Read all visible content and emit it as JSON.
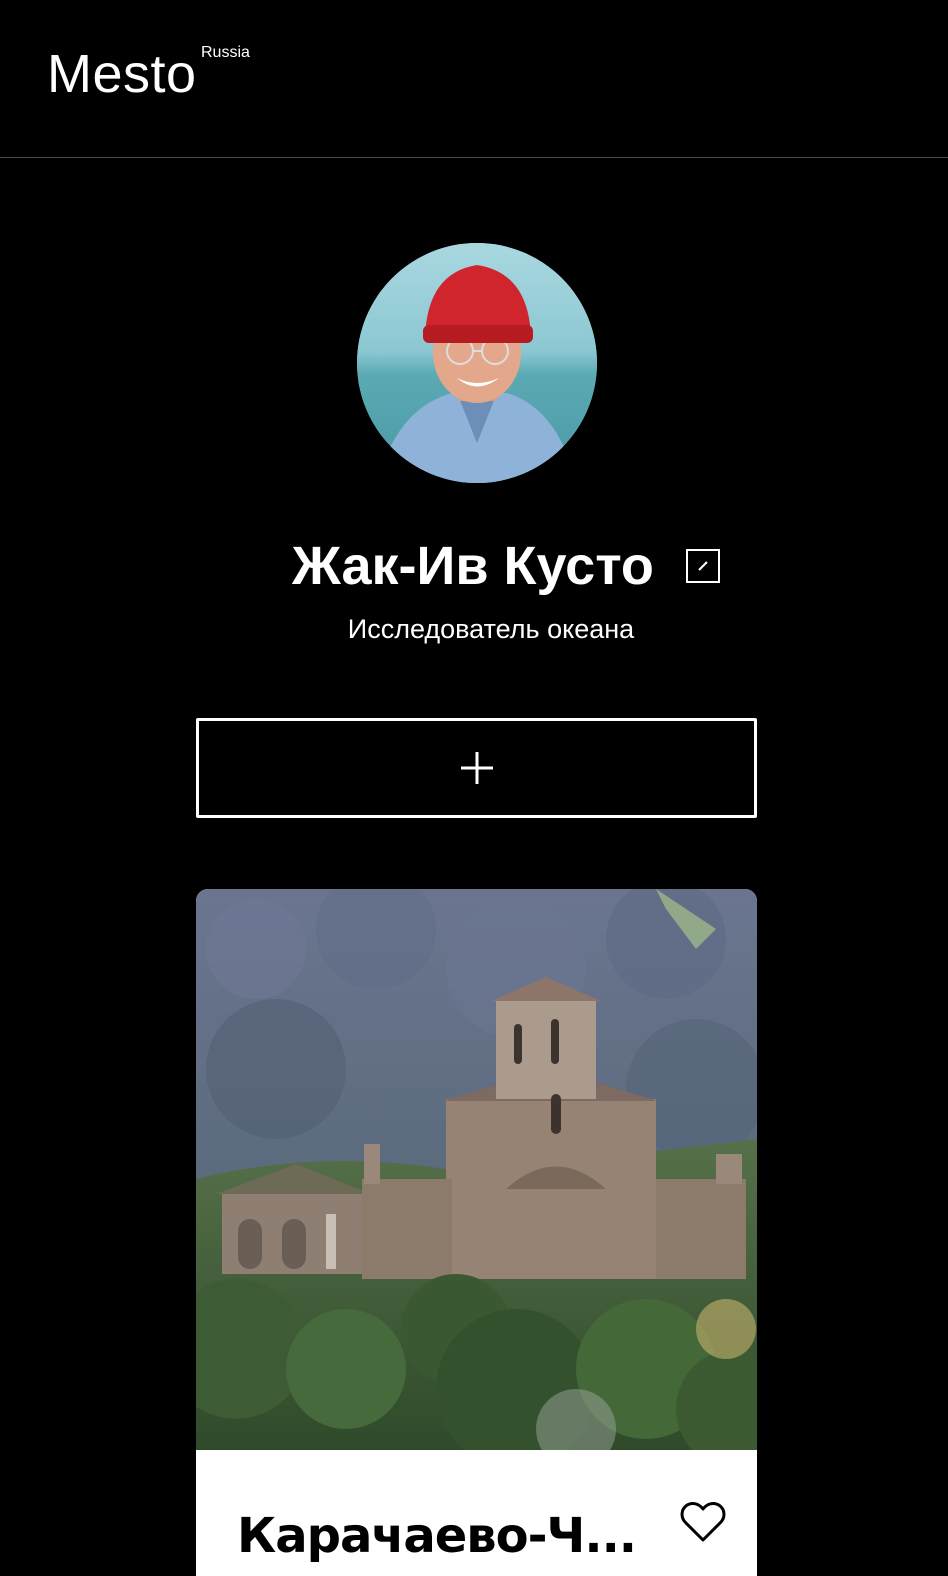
{
  "header": {
    "logo_text": "Mesto",
    "logo_sub": "Russia"
  },
  "profile": {
    "avatar_icon": "avatar-photo",
    "name": "Жак-Ив Кусто",
    "about": "Исследователь океана",
    "edit_icon": "pencil-icon",
    "add_icon": "plus-icon"
  },
  "cards": [
    {
      "title": "Карачаево-Ч...",
      "image_icon": "church-landscape",
      "like_icon": "heart-icon"
    }
  ],
  "colors": {
    "background": "#000000",
    "text": "#ffffff",
    "card_background": "#ffffff",
    "card_text": "#000000",
    "divider": "#545454"
  }
}
